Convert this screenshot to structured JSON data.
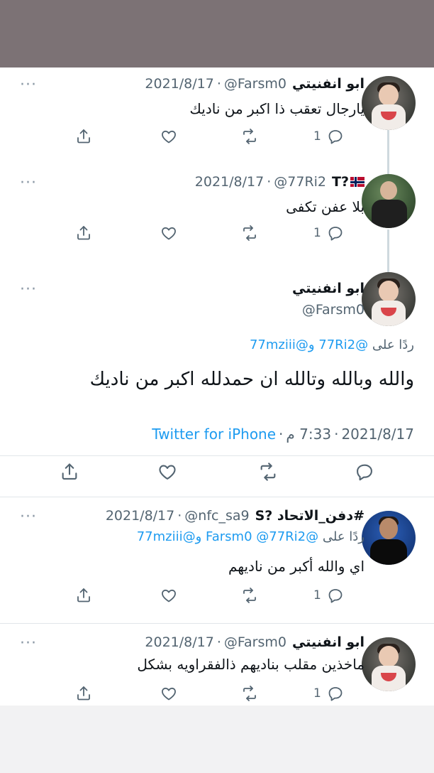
{
  "tweets": [
    {
      "name": "ابو انفنيتي",
      "handle": "@Farsm0",
      "sep": "·",
      "date": "2021/8/17",
      "text": "يارجال تعقب ذا اكبر من ناديك",
      "reply_count": "1",
      "more": "···"
    },
    {
      "name": "T?",
      "handle": "@77Ri2",
      "sep": "·",
      "date": "2021/8/17",
      "text": "بلا عفن تكفى",
      "reply_count": "1",
      "more": "···"
    },
    {
      "name": "#دفن_الاتحاد ?S",
      "handle": "@nfc_sa9",
      "sep": "·",
      "date": "2021/8/17",
      "reply_prefix": "ردًا على",
      "reply_mentions": "@Farsm0 @77Ri2 و@77mziii",
      "text": "اي والله أكبر من ناديهم",
      "reply_count": "1",
      "more": "···"
    },
    {
      "name": "ابو انفنيتي",
      "handle": "@Farsm0",
      "sep": "·",
      "date": "2021/8/17",
      "text": "ماخذين مقلب بناديهم ذالفقراويه بشكل",
      "reply_count": "1",
      "more": "···"
    }
  ],
  "main": {
    "name": "ابو انفنيتي",
    "handle": "@Farsm0",
    "reply_prefix": "ردًا على",
    "reply_mentions": "@77Ri2 و@77mziii",
    "text": "والله وبالله وتالله ان حمدلله اكبر من ناديك",
    "date": "2021/8/17",
    "time": "7:33 م",
    "sep": "·",
    "source": "Twitter for iPhone",
    "more": "···"
  },
  "colors": {
    "accent": "#1d9bf0",
    "muted": "#536471",
    "topbar": "#7c7275"
  }
}
